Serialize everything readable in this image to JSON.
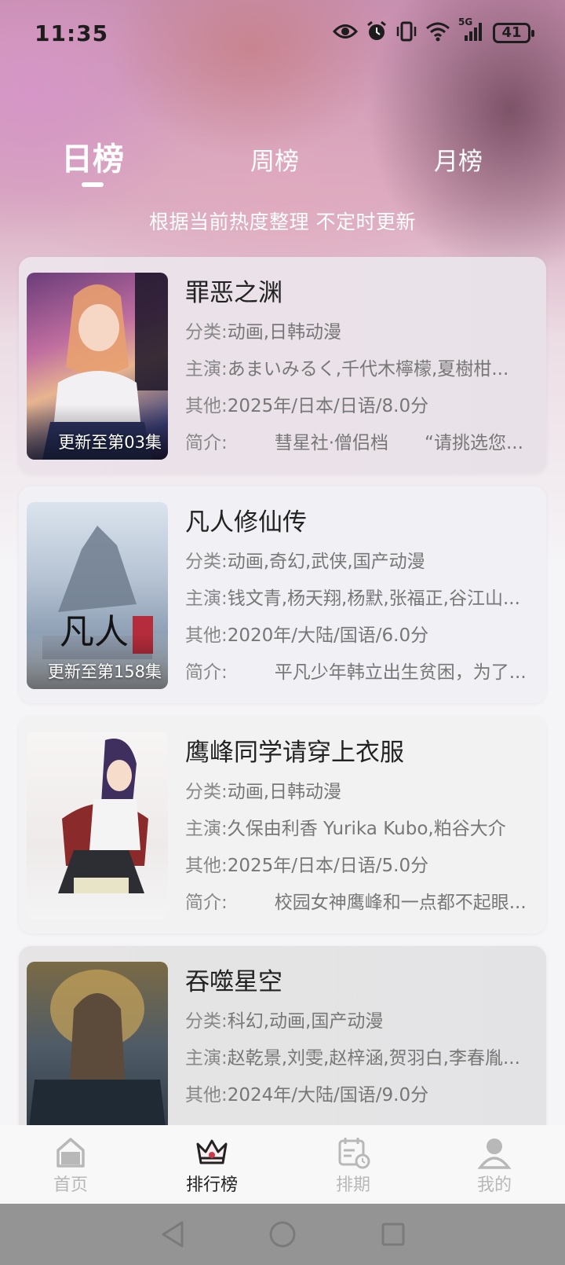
{
  "status": {
    "time": "11:35",
    "battery": "41",
    "network": "5G",
    "icons": [
      "eye-icon",
      "alarm-icon",
      "vibrate-icon",
      "wifi-icon",
      "signal-icon",
      "battery-icon"
    ]
  },
  "tabs": [
    {
      "label": "日榜",
      "active": true
    },
    {
      "label": "周榜",
      "active": false
    },
    {
      "label": "月榜",
      "active": false
    }
  ],
  "subtitle": "根据当前热度整理 不定时更新",
  "labels": {
    "category": "分类:",
    "cast": "主演:",
    "other": "其他:",
    "intro": "简介:"
  },
  "items": [
    {
      "title": "罪恶之渊",
      "category": "动画,日韩动漫",
      "cast": "あまいみるく,千代木檸檬,夏樹柑...",
      "other": "2025年/日本/日语/8.0分",
      "intro": "彗星社·僧侣档　　“请挑选您...",
      "badge": "更新至第03集"
    },
    {
      "title": "凡人修仙传",
      "category": "动画,奇幻,武侠,国产动漫",
      "cast": "钱文青,杨天翔,杨默,张福正,谷江山...",
      "other": "2020年/大陆/国语/6.0分",
      "intro": "平凡少年韩立出生贫困，为了...",
      "badge": "更新至第158集"
    },
    {
      "title": "鹰峰同学请穿上衣服",
      "category": "动画,日韩动漫",
      "cast": "久保由利香 Yurika Kubo,粕谷大介",
      "other": "2025年/日本/日语/5.0分",
      "intro": "校园女神鹰峰和一点都不起眼...",
      "badge": ""
    },
    {
      "title": "吞噬星空",
      "category": "科幻,动画,国产动漫",
      "cast": "赵乾景,刘雯,赵梓涵,贺羽白,李春胤...",
      "other": "2024年/大陆/国语/9.0分",
      "intro": "",
      "badge": ""
    }
  ],
  "tabbar": [
    {
      "label": "首页",
      "icon": "home-icon",
      "active": false
    },
    {
      "label": "排行榜",
      "icon": "crown-icon",
      "active": true
    },
    {
      "label": "排期",
      "icon": "calendar-icon",
      "active": false
    },
    {
      "label": "我的",
      "icon": "user-icon",
      "active": false
    }
  ],
  "colors": {
    "accent": "#c93a4a",
    "tab_inactive": "#b8b8b8",
    "tab_active": "#222222"
  }
}
